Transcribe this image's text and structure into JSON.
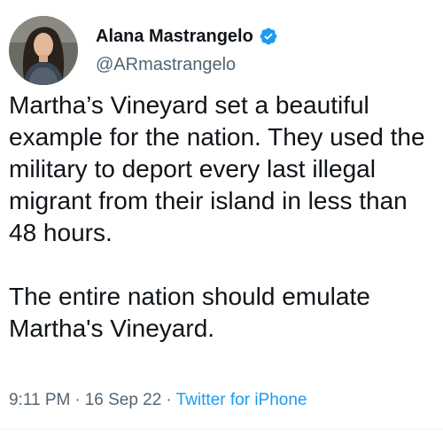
{
  "user": {
    "display_name": "Alana Mastrangelo",
    "handle": "@ARmastrangelo",
    "avatar_icon": "profile-photo",
    "verified_icon": "verified-badge-icon",
    "verified_color": "#1d9bf0"
  },
  "tweet": {
    "paragraphs": [
      "Martha’s Vineyard set a beautiful example for the nation. They used the military to deport every last illegal migrant from their island in less than 48 hours.",
      "The entire nation should emulate Martha's Vineyard."
    ]
  },
  "meta": {
    "time": "9:11 PM",
    "separator": "·",
    "date": "16 Sep 22",
    "source": "Twitter for iPhone",
    "source_color": "#1d9bf0"
  }
}
